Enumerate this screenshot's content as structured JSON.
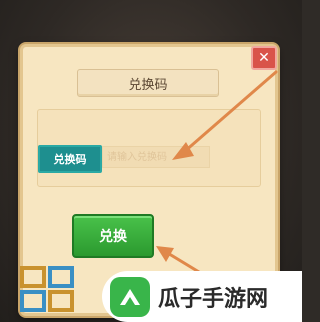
{
  "dialog": {
    "title": "兑换码",
    "code_label": "兑换码",
    "input_placeholder": "请输入兑换码",
    "redeem_label": "兑换",
    "close_symbol": "✕"
  },
  "watermark": {
    "brand": "瓜子手游网"
  },
  "colors": {
    "dialog_bg": "#f7e6c1",
    "label_teal": "#1e8f8f",
    "button_green": "#3aad3c",
    "close_red": "#d9534a",
    "arrow_orange": "#e0884a"
  }
}
